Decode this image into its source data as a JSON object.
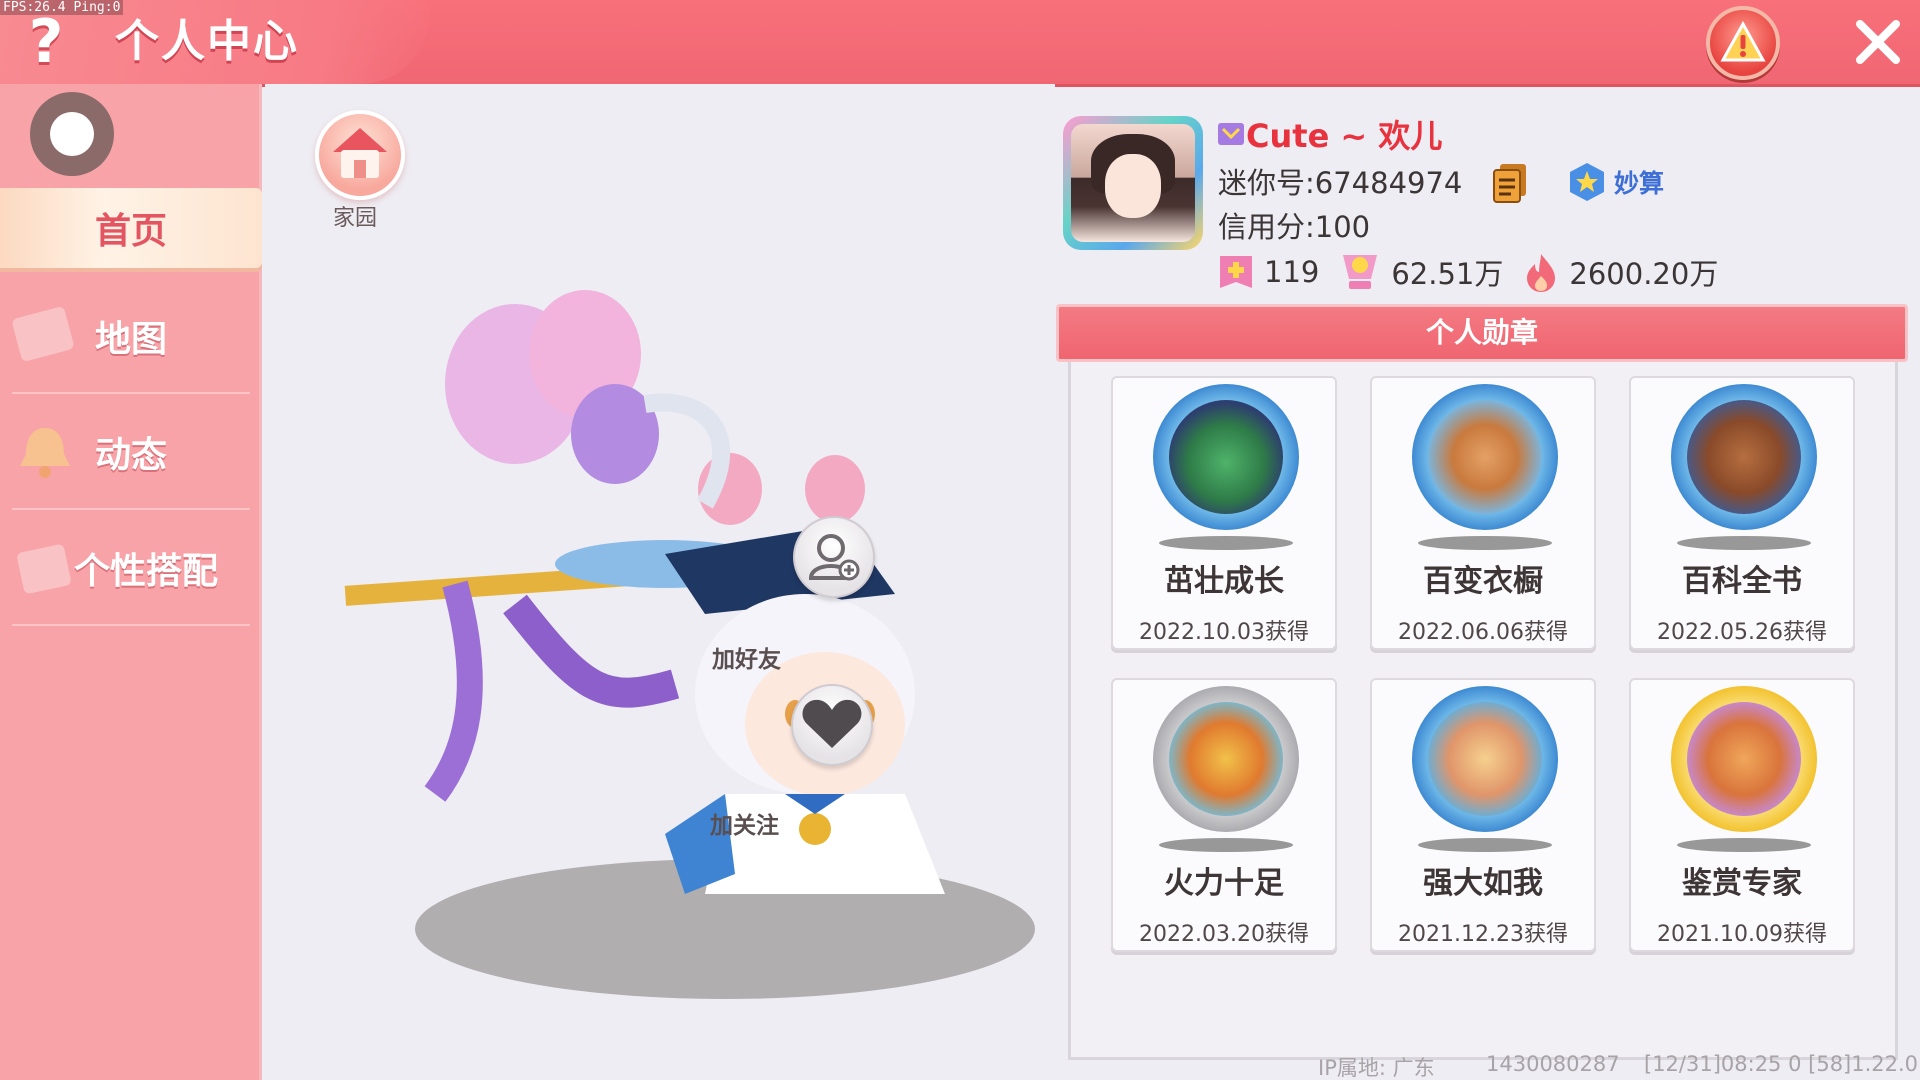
{
  "debug": {
    "fps_text": "FPS:26.4  Ping:0"
  },
  "header": {
    "help_symbol": "?",
    "title": "个人中心",
    "close_symbol": "✕"
  },
  "sidebar": {
    "items": [
      {
        "label": "首页",
        "active": true
      },
      {
        "label": "地图",
        "active": false
      },
      {
        "label": "动态",
        "active": false
      },
      {
        "label": "个性搭配",
        "active": false
      }
    ]
  },
  "stage": {
    "home_label": "家园",
    "add_friend_label": "加好友",
    "follow_label": "加关注"
  },
  "profile": {
    "name": "Cute ~ 欢儿",
    "mini_id": "迷你号:67484974",
    "credit": "信用分:100",
    "tag": "妙算",
    "stats": [
      {
        "icon": "like-icon",
        "value": "119"
      },
      {
        "icon": "trophy-icon",
        "value": "62.51万"
      },
      {
        "icon": "flame-icon",
        "value": "2600.20万"
      }
    ]
  },
  "medals": {
    "title": "个人勋章",
    "items": [
      {
        "name": "茁壮成长",
        "date": "2022.10.03获得",
        "style": "blue"
      },
      {
        "name": "百变衣橱",
        "date": "2022.06.06获得",
        "style": "blue"
      },
      {
        "name": "百科全书",
        "date": "2022.05.26获得",
        "style": "blue"
      },
      {
        "name": "火力十足",
        "date": "2022.03.20获得",
        "style": "silver"
      },
      {
        "name": "强大如我",
        "date": "2021.12.23获得",
        "style": "blue"
      },
      {
        "name": "鉴赏专家",
        "date": "2021.10.09获得",
        "style": "gold"
      }
    ]
  },
  "footer": {
    "ip": "IP属地: 广东",
    "uid": "1430080287",
    "version": "[12/31]08:25 0  [58]1.22.0"
  },
  "colors": {
    "header": "#f06773",
    "sidebar": "#f7a3a8",
    "accent_red": "#e8333f",
    "tag_blue": "#3d6fd6"
  }
}
